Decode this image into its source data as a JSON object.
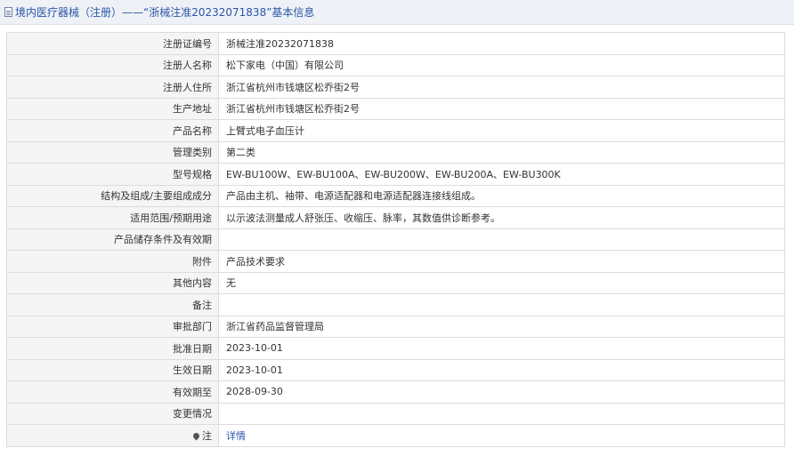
{
  "header": {
    "title": "境内医疗器械（注册）——“浙械注准20232071838”基本信息"
  },
  "rows": [
    {
      "label": "注册证编号",
      "value": "浙械注准20232071838"
    },
    {
      "label": "注册人名称",
      "value": "松下家电（中国）有限公司"
    },
    {
      "label": "注册人住所",
      "value": "浙江省杭州市钱塘区松乔街2号"
    },
    {
      "label": "生产地址",
      "value": "浙江省杭州市钱塘区松乔街2号"
    },
    {
      "label": "产品名称",
      "value": "上臂式电子血压计"
    },
    {
      "label": "管理类别",
      "value": "第二类"
    },
    {
      "label": "型号规格",
      "value": "EW-BU100W、EW-BU100A、EW-BU200W、EW-BU200A、EW-BU300K"
    },
    {
      "label": "结构及组成/主要组成成分",
      "value": "产品由主机、袖带、电源适配器和电源适配器连接线组成。"
    },
    {
      "label": "适用范围/预期用途",
      "value": "以示波法测量成人舒张压、收缩压、脉率，其数值供诊断参考。"
    },
    {
      "label": "产品储存条件及有效期",
      "value": ""
    },
    {
      "label": "附件",
      "value": "产品技术要求"
    },
    {
      "label": "其他内容",
      "value": "无"
    },
    {
      "label": "备注",
      "value": ""
    },
    {
      "label": "审批部门",
      "value": "浙江省药品监督管理局"
    },
    {
      "label": "批准日期",
      "value": "2023-10-01"
    },
    {
      "label": "生效日期",
      "value": "2023-10-01"
    },
    {
      "label": "有效期至",
      "value": "2028-09-30"
    },
    {
      "label": "变更情况",
      "value": ""
    }
  ],
  "note_row": {
    "label": "注",
    "link_text": "详情"
  },
  "colors": {
    "header_bg": "#eef1f6",
    "header_text": "#2a56a8",
    "label_bg": "#f5f5f5",
    "border": "#dcdcdc",
    "link": "#2a56a8"
  }
}
